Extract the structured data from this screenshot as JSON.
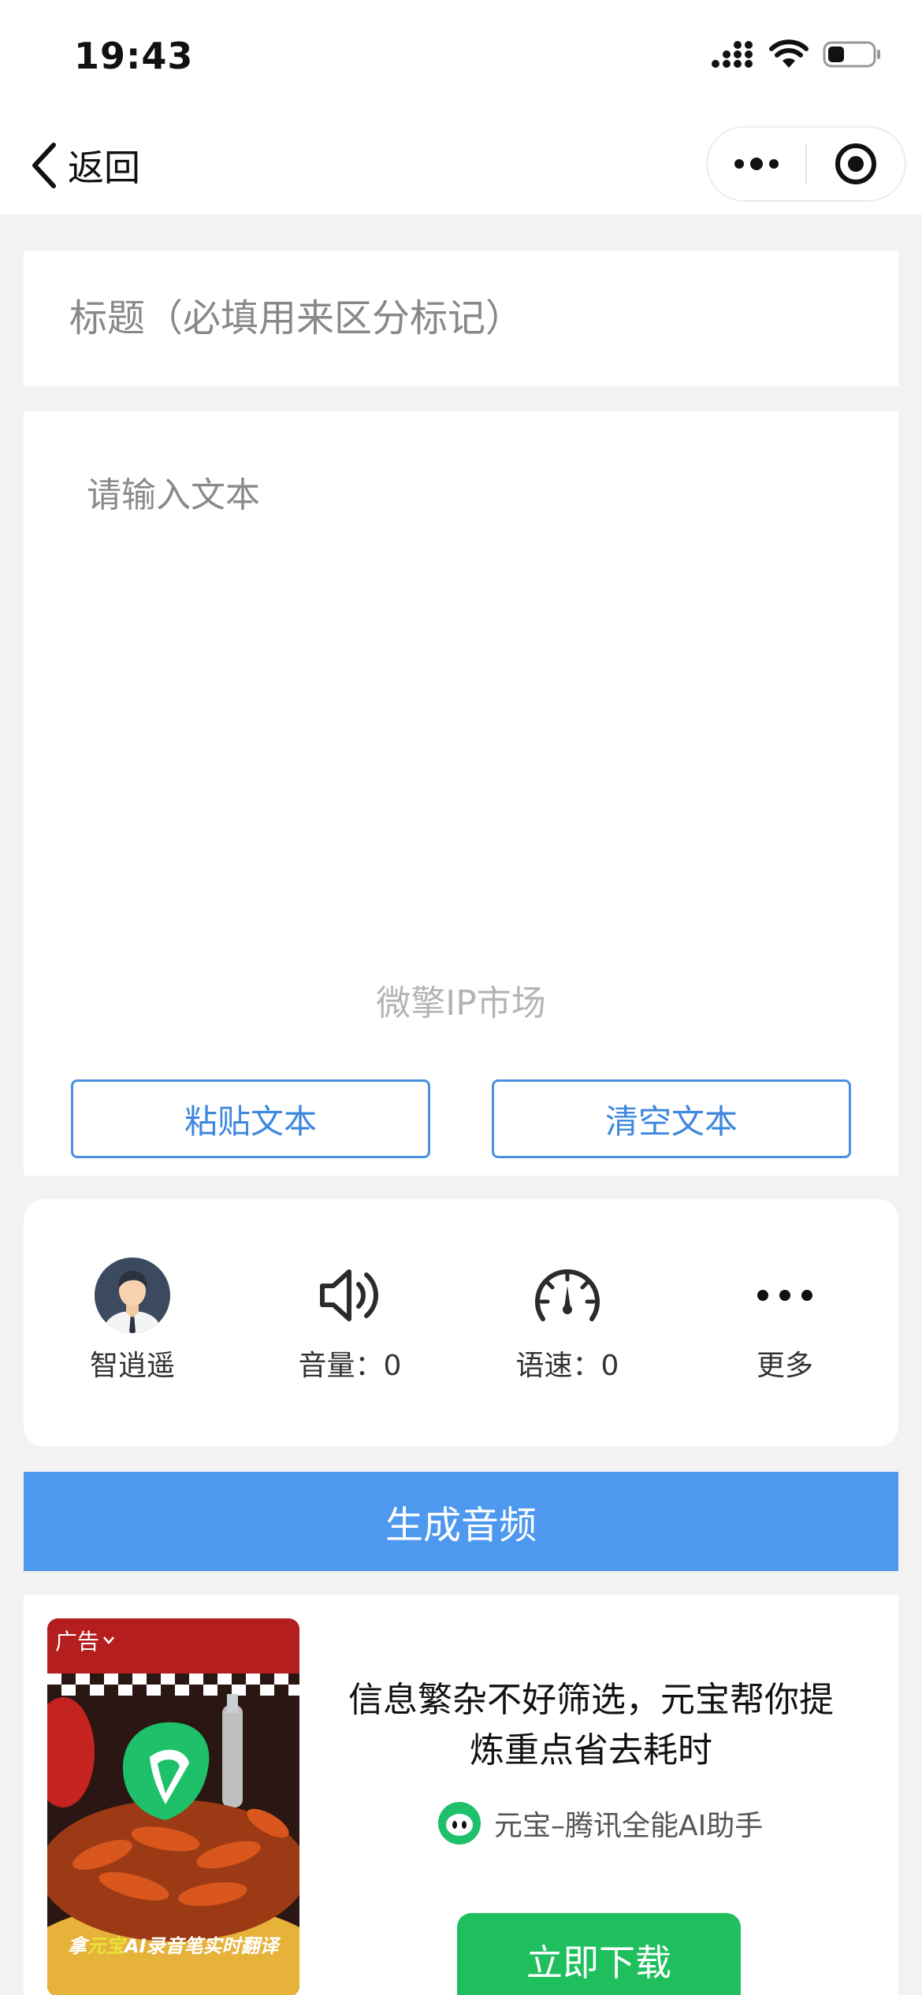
{
  "status_bar": {
    "time": "19:43"
  },
  "nav": {
    "back_label": "返回"
  },
  "title_field": {
    "placeholder": "标题（必填用来区分标记）",
    "value": ""
  },
  "text_field": {
    "placeholder": "请输入文本",
    "value": ""
  },
  "watermark": "微擎IP市场",
  "text_actions": {
    "paste_label": "粘贴文本",
    "clear_label": "清空文本"
  },
  "settings": {
    "voice_label": "智逍遥",
    "volume_label": "音量：0",
    "speed_label": "语速：0",
    "more_label": "更多"
  },
  "generate_label": "生成音频",
  "ad": {
    "tag": "广告",
    "image_caption_prefix": "拿",
    "image_caption_highlight": "元宝",
    "image_caption_rest": "AI录音笔实时翻译",
    "headline": "信息繁杂不好筛选，元宝帮你提炼重点省去耗时",
    "brand_name": "元宝–腾讯全能AI助手",
    "cta_label": "立即下载"
  },
  "colors": {
    "accent": "#4e98ef",
    "accent_border": "#4a90e2",
    "download_green": "#1fbf5e"
  }
}
